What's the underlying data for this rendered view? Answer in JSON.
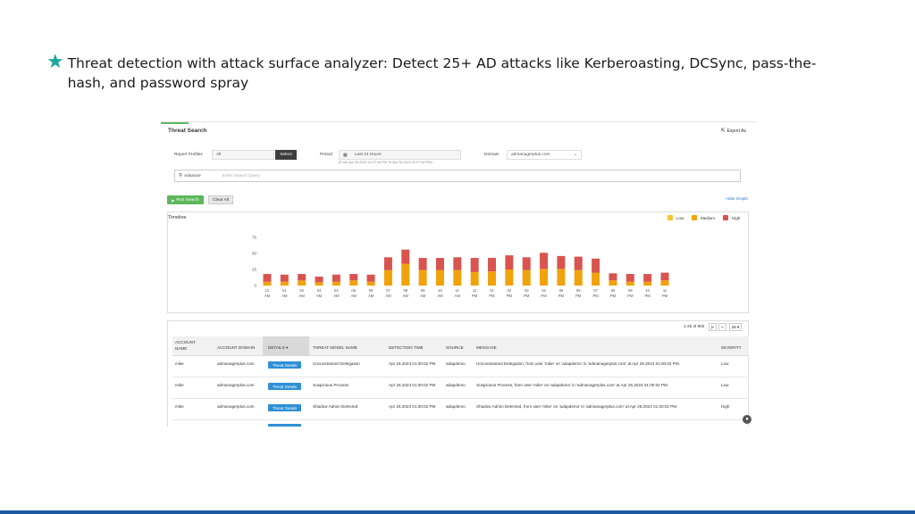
{
  "headline": {
    "text": "Threat detection with attack surface analyzer: Detect 25+ AD attacks like Kerberoasting, DCSync, pass-the-hash, and password spray"
  },
  "screenshot": {
    "title": "Threat Search",
    "export_label": "Export As",
    "filters": {
      "report_profiles_label": "Report Profiles",
      "report_profiles_value": "All",
      "select_label": "Select",
      "period_label": "Period",
      "period_value": "Last 24 Hours",
      "period_hint": "(From Apr 25,2024 01:07:48 PM To Apr 26,2024 01:07:48 PM)",
      "domain_label": "Domain",
      "domain_value": "admanagerplus.com"
    },
    "search": {
      "advance_label": "Advance",
      "placeholder": "Enter Search Query"
    },
    "run_search_label": "Run Search",
    "clear_all_label": "Clear All",
    "hide_graph_label": "Hide Graph",
    "timeline_label": "Timeline",
    "legend": {
      "low": "Low",
      "medium": "Medium",
      "high": "High"
    },
    "colors": {
      "low": "#f4c430",
      "medium": "#f0a30a",
      "high": "#d9534f"
    },
    "pager": {
      "range": "1-25 of 800",
      "first": "|«",
      "prev": "«",
      "page_size": "25 ▾"
    },
    "table": {
      "headers": {
        "account_name": "ACCOUNT NAME",
        "account_domain": "ACCOUNT DOMAIN",
        "details": "DETAILS",
        "threat_model": "THREAT MODEL NAME",
        "detection_time": "DETECTION TIME",
        "source": "SOURCE",
        "message": "MESSAGE",
        "severity": "SEVERITY"
      },
      "details_button": "Threat Details",
      "rows": [
        {
          "account_name": "mike",
          "account_domain": "admanagerplus.com",
          "threat_model": "Unconstrained Delegation",
          "detection_time": "Apr 26,2024 01:00:02 PM",
          "source": "adapdemo",
          "message": "Unconstrained Delegation, from user 'mike' on 'adapdemo' in 'admanagerplus.com' at Apr 26,2024 01:00:02 PM.",
          "severity": "Low"
        },
        {
          "account_name": "mike",
          "account_domain": "admanagerplus.com",
          "threat_model": "Suspicious Process",
          "detection_time": "Apr 26,2024 01:00:02 PM",
          "source": "adapdemo",
          "message": "Suspicious Process, from user 'mike' on 'adapdemo' in 'admanagerplus.com' at Apr 26,2024 01:00:02 PM.",
          "severity": "Low"
        },
        {
          "account_name": "mike",
          "account_domain": "admanagerplus.com",
          "threat_model": "Shadow Admin Detected",
          "detection_time": "Apr 26,2024 01:00:02 PM",
          "source": "adapdemo",
          "message": "Shadow Admin Detected, from user 'mike' on 'adapdemo' in 'admanagerplus.com' at Apr 26,2024 01:00:02 PM.",
          "severity": "High"
        }
      ]
    },
    "chart_data": {
      "type": "bar",
      "stacked": true,
      "ylim": [
        0,
        75
      ],
      "yticks": [
        0,
        25,
        50,
        75
      ],
      "categories": [
        "12 AM",
        "01 AM",
        "02 AM",
        "03 AM",
        "04 AM",
        "05 AM",
        "06 AM",
        "07 AM",
        "08 AM",
        "09 AM",
        "10 AM",
        "11 AM",
        "12 PM",
        "01 PM",
        "02 PM",
        "03 PM",
        "04 PM",
        "05 PM",
        "06 PM",
        "07 PM",
        "08 PM",
        "09 PM",
        "10 PM",
        "11 PM"
      ],
      "series": [
        {
          "name": "Medium",
          "values": [
            6,
            6,
            8,
            5,
            6,
            8,
            6,
            24,
            34,
            24,
            24,
            24,
            21,
            22,
            25,
            24,
            26,
            26,
            24,
            20,
            8,
            6,
            6,
            8
          ]
        },
        {
          "name": "High",
          "values": [
            12,
            11,
            10,
            9,
            11,
            10,
            11,
            20,
            22,
            19,
            19,
            20,
            22,
            21,
            22,
            20,
            25,
            20,
            21,
            22,
            11,
            12,
            12,
            12
          ]
        }
      ]
    }
  }
}
